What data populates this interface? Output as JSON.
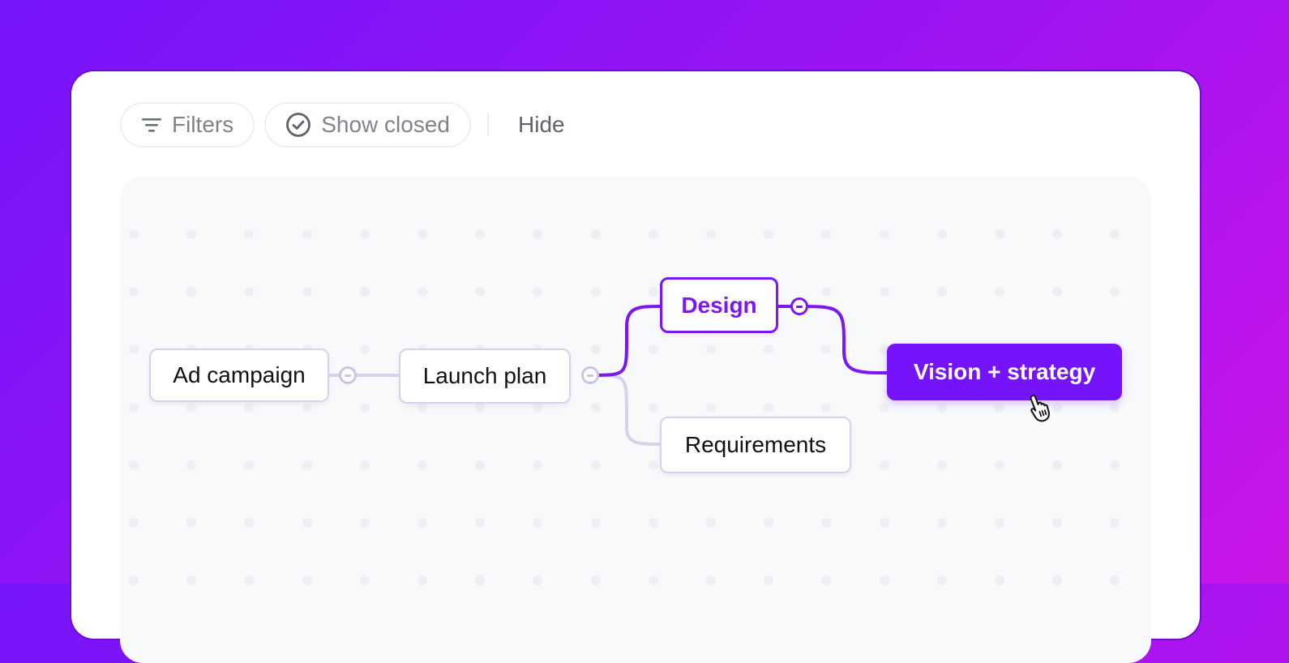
{
  "toolbar": {
    "filters_label": "Filters",
    "filters_icon": "filter-lines-icon",
    "show_closed_label": "Show closed",
    "show_closed_icon": "check-circle-icon",
    "hide_label": "Hide"
  },
  "mindmap": {
    "nodes": [
      {
        "id": "ad-campaign",
        "label": "Ad campaign",
        "state": "normal"
      },
      {
        "id": "launch-plan",
        "label": "Launch plan",
        "state": "normal"
      },
      {
        "id": "design",
        "label": "Design",
        "state": "active-path"
      },
      {
        "id": "requirements",
        "label": "Requirements",
        "state": "normal"
      },
      {
        "id": "vision-strategy",
        "label": "Vision + strategy",
        "state": "selected"
      }
    ],
    "edges": [
      {
        "from": "ad-campaign",
        "to": "launch-plan",
        "state": "normal"
      },
      {
        "from": "launch-plan",
        "to": "design",
        "state": "active"
      },
      {
        "from": "launch-plan",
        "to": "requirements",
        "state": "normal"
      },
      {
        "from": "design",
        "to": "vision-strategy",
        "state": "active"
      }
    ],
    "collapse_toggles": [
      "ad-campaign",
      "launch-plan",
      "design"
    ]
  },
  "colors": {
    "accent": "#7514FA",
    "active_edge": "#7C16F2",
    "inactive_edge": "#D6D2EE",
    "canvas_bg": "#F8F9FB",
    "gradient_start": "#7514FA",
    "gradient_end": "#CB15E8"
  },
  "cursor": "hand-pointer-icon"
}
